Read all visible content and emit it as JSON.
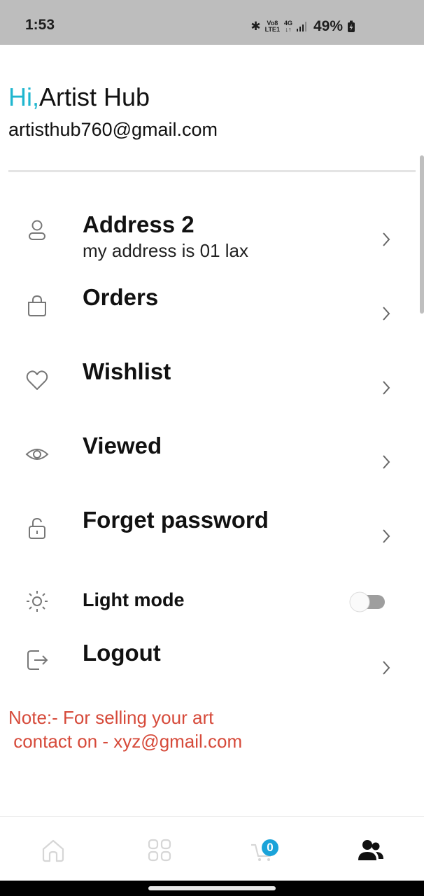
{
  "status_bar": {
    "time": "1:53",
    "volte_line1": "Vo8",
    "volte_line2": "LTE1",
    "network": "4G",
    "network_arrows": "↓↑",
    "battery": "49%"
  },
  "header": {
    "hi": "Hi,",
    "name": "Artist Hub",
    "email": "artisthub760@gmail.com"
  },
  "menu": {
    "address_title": "Address 2",
    "address_sub": "my address is 01 lax",
    "orders": "Orders",
    "wishlist": "Wishlist",
    "viewed": "Viewed",
    "forget_password": "Forget password",
    "light_mode": "Light mode",
    "logout": "Logout"
  },
  "light_mode_enabled": false,
  "note": {
    "line1": "Note:- For selling your art",
    "line2": " contact on - xyz@gmail.com"
  },
  "bottom_nav": {
    "items": [
      "home-icon",
      "grid-icon",
      "cart-icon",
      "profile-icon"
    ],
    "cart_badge": "0",
    "active": "profile",
    "accent_color": "#1aa3d9"
  },
  "colors": {
    "hi": "#1fb6cf",
    "note": "#d64a3a",
    "status_bar": "#bdbdbd"
  }
}
